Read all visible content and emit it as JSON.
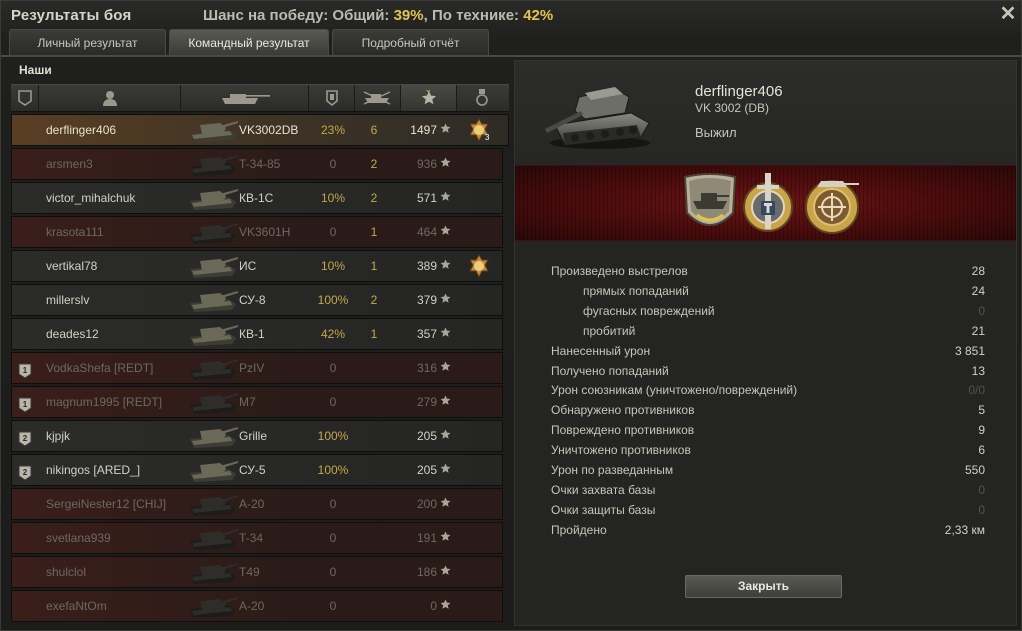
{
  "window": {
    "title": "Результаты боя",
    "chance_prefix": "Шанс на победу: Общий: ",
    "chance_total": "39%",
    "chance_mid": ", По технике: ",
    "chance_tech": "42%"
  },
  "tabs": [
    {
      "label": "Личный результат",
      "active": false
    },
    {
      "label": "Командный результат",
      "active": true
    },
    {
      "label": "Подробный отчёт",
      "active": false
    }
  ],
  "team": {
    "label": "Наши",
    "columns": [
      "squad-icon",
      "player-icon",
      "tank-icon",
      "damage-icon",
      "kills-icon",
      "xp-star-icon",
      "medal-icon"
    ],
    "rows": [
      {
        "name": "derflinger406",
        "tank": "VK3002DB",
        "pct": "23%",
        "kills": "6",
        "xp": "1497",
        "state": "self",
        "squad": "",
        "medal": true,
        "medal_num": "3"
      },
      {
        "name": "arsmen3",
        "tank": "T-34-85",
        "pct": "0",
        "kills": "2",
        "xp": "936",
        "state": "dead",
        "squad": "",
        "medal": false
      },
      {
        "name": "victor_mihalchuk",
        "tank": "КВ-1С",
        "pct": "10%",
        "kills": "2",
        "xp": "571",
        "state": "alive",
        "squad": "",
        "medal": false
      },
      {
        "name": "krasota111",
        "tank": "VK3601H",
        "pct": "0",
        "kills": "1",
        "xp": "464",
        "state": "dead",
        "squad": "",
        "medal": false
      },
      {
        "name": "vertikal78",
        "tank": "ИС",
        "pct": "10%",
        "kills": "1",
        "xp": "389",
        "state": "alive",
        "squad": "",
        "medal": true,
        "medal_num": ""
      },
      {
        "name": "millerslv",
        "tank": "СУ-8",
        "pct": "100%",
        "kills": "2",
        "xp": "379",
        "state": "alive",
        "squad": "",
        "medal": false
      },
      {
        "name": "deades12",
        "tank": "КВ-1",
        "pct": "42%",
        "kills": "1",
        "xp": "357",
        "state": "alive",
        "squad": "",
        "medal": false
      },
      {
        "name": "VodkaShefa [REDT]",
        "tank": "PzIV",
        "pct": "0",
        "kills": "",
        "xp": "316",
        "state": "dead",
        "squad": "1",
        "medal": false
      },
      {
        "name": "magnum1995 [REDT]",
        "tank": "M7",
        "pct": "0",
        "kills": "",
        "xp": "279",
        "state": "dead",
        "squad": "1",
        "medal": false
      },
      {
        "name": "kjpjk",
        "tank": "Grille",
        "pct": "100%",
        "kills": "",
        "xp": "205",
        "state": "alive",
        "squad": "2",
        "medal": false
      },
      {
        "name": "nikingos [ARED_]",
        "tank": "СУ-5",
        "pct": "100%",
        "kills": "",
        "xp": "205",
        "state": "alive",
        "squad": "2",
        "medal": false
      },
      {
        "name": "SergeiNester12 [CHIJ]",
        "tank": "A-20",
        "pct": "0",
        "kills": "",
        "xp": "200",
        "state": "dead",
        "squad": "",
        "medal": false
      },
      {
        "name": "svetlana939",
        "tank": "T-34",
        "pct": "0",
        "kills": "",
        "xp": "191",
        "state": "dead",
        "squad": "",
        "medal": false
      },
      {
        "name": "shulclol",
        "tank": "T49",
        "pct": "0",
        "kills": "",
        "xp": "186",
        "state": "dead",
        "squad": "",
        "medal": false
      },
      {
        "name": "exefaNtOm",
        "tank": "A-20",
        "pct": "0",
        "kills": "",
        "xp": "0",
        "state": "dead",
        "squad": "",
        "medal": false
      }
    ]
  },
  "detail": {
    "player_name": "derflinger406",
    "tank": "VK 3002 (DB)",
    "status": "Выжил",
    "achievements": [
      "tank-expert-badge",
      "defender-medal",
      "sniper-medal"
    ],
    "stats": [
      {
        "label": "Произведено выстрелов",
        "value": "28",
        "sub": false,
        "zero": false
      },
      {
        "label": "прямых попаданий",
        "value": "24",
        "sub": true,
        "zero": false
      },
      {
        "label": "фугасных повреждений",
        "value": "0",
        "sub": true,
        "zero": true
      },
      {
        "label": "пробитий",
        "value": "21",
        "sub": true,
        "zero": false
      },
      {
        "label": "Нанесенный урон",
        "value": "3 851",
        "sub": false,
        "zero": false
      },
      {
        "label": "Получено попаданий",
        "value": "13",
        "sub": false,
        "zero": false
      },
      {
        "label": "Урон союзникам (уничтожено/повреждений)",
        "value": "0/0",
        "sub": false,
        "zero": true
      },
      {
        "label": "Обнаружено противников",
        "value": "5",
        "sub": false,
        "zero": false
      },
      {
        "label": "Повреждено противников",
        "value": "9",
        "sub": false,
        "zero": false
      },
      {
        "label": "Уничтожено противников",
        "value": "6",
        "sub": false,
        "zero": false
      },
      {
        "label": "Урон по разведанным",
        "value": "550",
        "sub": false,
        "zero": false
      },
      {
        "label": "Очки захвата базы",
        "value": "0",
        "sub": false,
        "zero": true
      },
      {
        "label": "Очки защиты базы",
        "value": "0",
        "sub": false,
        "zero": true
      },
      {
        "label": "Пройдено",
        "value": "2,33 км",
        "sub": false,
        "zero": false
      }
    ],
    "close_label": "Закрыть"
  },
  "colors": {
    "accent": "#e0c553",
    "banner": "#6a1414",
    "dead_row": "#3a1e1a"
  }
}
